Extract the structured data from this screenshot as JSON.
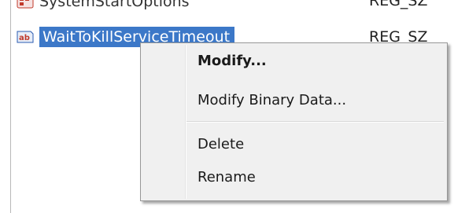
{
  "registry_list": {
    "rows": [
      {
        "name": "SystemStartOptions",
        "type": "REG_SZ",
        "icon": "reg-binary-icon"
      },
      {
        "name": "WaitToKillServiceTimeout",
        "type": "REG_SZ",
        "icon": "reg-string-icon",
        "selected": true
      }
    ]
  },
  "context_menu": {
    "items": [
      {
        "label": "Modify...",
        "default": true
      },
      {
        "label": "Modify Binary Data..."
      },
      {
        "label": "Delete"
      },
      {
        "label": "Rename"
      }
    ]
  },
  "colors": {
    "selection": "#3c78c8",
    "menu_background": "#f0f0f0"
  }
}
